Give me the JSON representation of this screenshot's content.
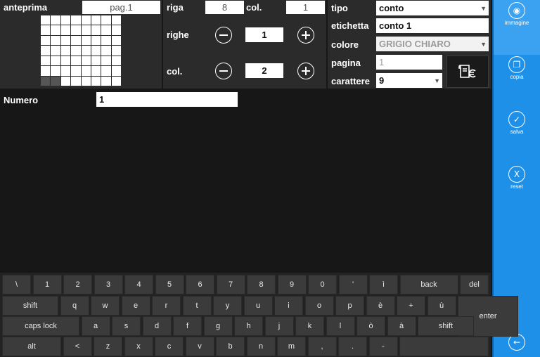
{
  "preview": {
    "label": "anteprima",
    "page": "pag.1"
  },
  "position": {
    "row_label": "riga",
    "row_value": "8",
    "col_label": "col.",
    "col_value": "1"
  },
  "size": {
    "rows_label": "righe",
    "rows_value": "1",
    "cols_label": "col.",
    "cols_value": "2"
  },
  "properties": {
    "type_label": "tipo",
    "type_value": "conto",
    "tag_label": "etichetta",
    "tag_value": "conto 1",
    "color_label": "colore",
    "color_value": "GRIGIO CHIARO",
    "page_label": "pagina",
    "page_value": "1",
    "font_label": "carattere",
    "font_value": "9"
  },
  "numero": {
    "label": "Numero",
    "value": "1"
  },
  "sidebar": {
    "immagine": "immagine",
    "copia": "copia",
    "salva": "salva",
    "reset": "reset"
  },
  "keyboard": {
    "row1": [
      "\\",
      "1",
      "2",
      "3",
      "4",
      "5",
      "6",
      "7",
      "8",
      "9",
      "0",
      "'",
      "ì",
      "back",
      "del"
    ],
    "row2": [
      "shift",
      "q",
      "w",
      "e",
      "r",
      "t",
      "y",
      "u",
      "i",
      "o",
      "p",
      "è",
      "+",
      "ù",
      "enter"
    ],
    "row3": [
      "caps lock",
      "a",
      "s",
      "d",
      "f",
      "g",
      "h",
      "j",
      "k",
      "l",
      "ò",
      "à",
      "shift"
    ],
    "row4": [
      "alt",
      "<",
      "z",
      "x",
      "c",
      "v",
      "b",
      "n",
      "m",
      ",",
      ".",
      "-",
      ""
    ]
  },
  "colors": {
    "accent": "#1e90e8",
    "panel": "#2b2b2b",
    "background": "#171717"
  }
}
